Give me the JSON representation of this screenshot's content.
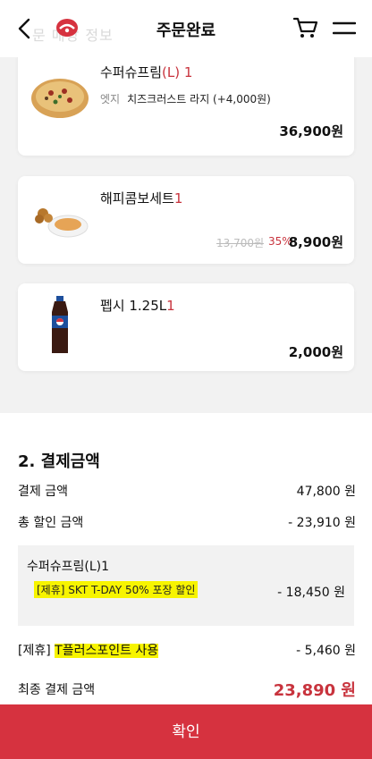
{
  "header": {
    "title": "주문완료",
    "faded_text": "문 매장 정보"
  },
  "items": [
    {
      "name": "수퍼슈프림",
      "size": "(L)",
      "qty": "1",
      "option_label": "엣지",
      "option_value": "치즈크러스트 라지 (+4,000원)",
      "price": "36,900원"
    },
    {
      "name": "해피콤보세트",
      "qty": "1",
      "original_price": "13,700원",
      "discount_rate": "35%",
      "price": "8,900원"
    },
    {
      "name": "펩시 1.25L",
      "qty": "1",
      "price": "2,000원"
    }
  ],
  "payment": {
    "title": "2. 결제금액",
    "subtotal_label": "결제 금액",
    "subtotal_value": "47,800 원",
    "discount_label": "총 할인 금액",
    "discount_value": "- 23,910 원",
    "discount_item": "수퍼슈프림(L)1",
    "discount_promo": "[제휴] SKT T-DAY 50% 포장 할인",
    "discount_item_value": "- 18,450 원",
    "tpoint_prefix": "[제휴]",
    "tpoint_label": "T플러스포인트 사용",
    "tpoint_value": "- 5,460 원",
    "final_label": "최종 결제 금액",
    "final_value": "23,890 원"
  },
  "confirm_label": "확인",
  "colors": {
    "brand_red": "#d6323f",
    "accent_red": "#c8333d",
    "highlight": "#f7f400"
  }
}
